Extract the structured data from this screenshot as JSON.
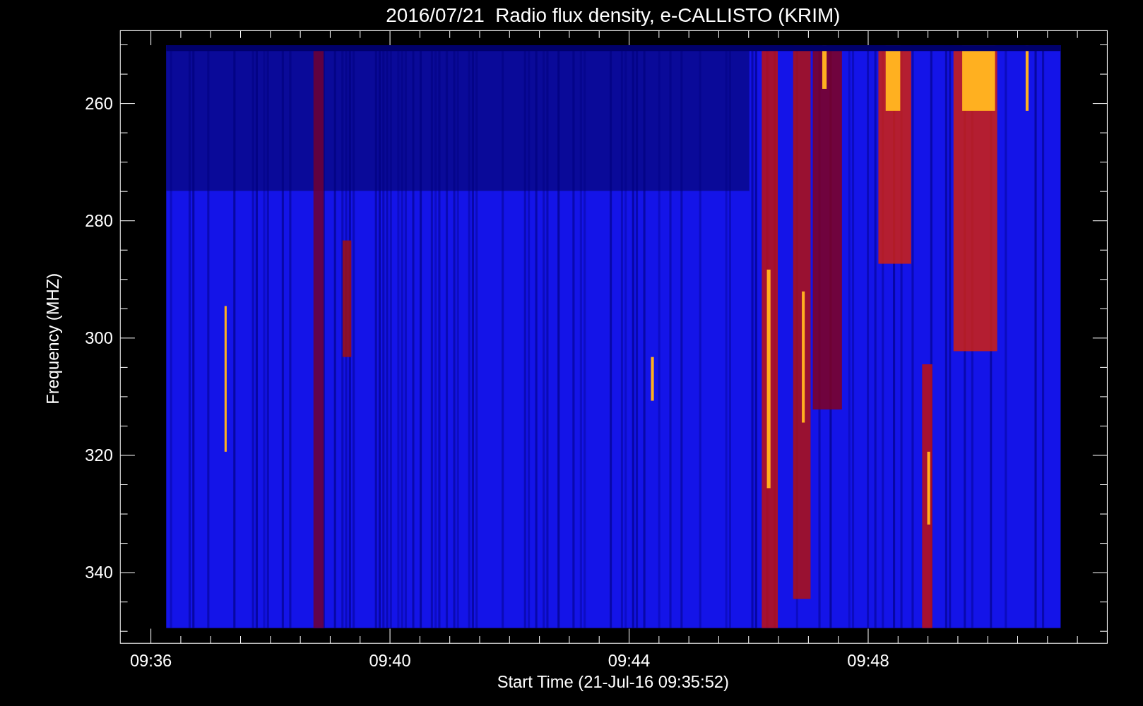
{
  "title": "2016/07/21  Radio flux density, e-CALLISTO (KRIM)",
  "y_axis": {
    "label": "Frequency (MHZ)",
    "ticks": [
      "260",
      "280",
      "300",
      "320",
      "340"
    ]
  },
  "x_axis": {
    "label": "Start Time (21-Jul-16 09:35:52)",
    "ticks": [
      "09:36",
      "09:40",
      "09:44",
      "09:48"
    ]
  }
}
